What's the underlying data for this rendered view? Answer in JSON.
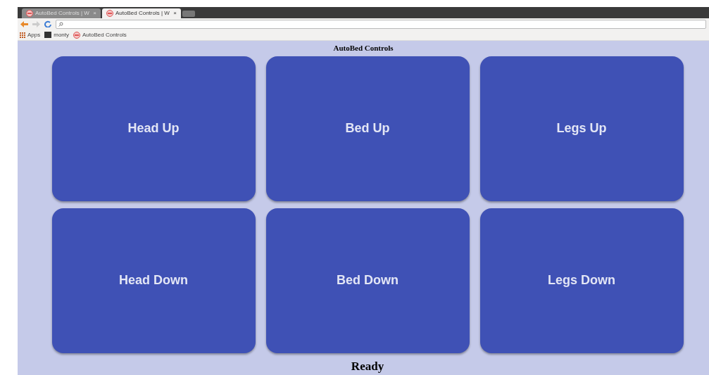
{
  "browser": {
    "tabs": [
      {
        "title": "AutoBed Controls | W",
        "close": "×",
        "selected": false
      },
      {
        "title": "AutoBed Controls | W",
        "close": "×",
        "selected": true
      }
    ],
    "bookmarks": [
      {
        "label": "Apps",
        "kind": "apps"
      },
      {
        "label": "monty",
        "kind": "site"
      },
      {
        "label": "AutoBed Controls",
        "kind": "page"
      }
    ]
  },
  "page": {
    "title": "AutoBed Controls",
    "buttons": [
      "Head Up",
      "Bed Up",
      "Legs Up",
      "Head Down",
      "Bed Down",
      "Legs Down"
    ],
    "status": "Ready"
  }
}
